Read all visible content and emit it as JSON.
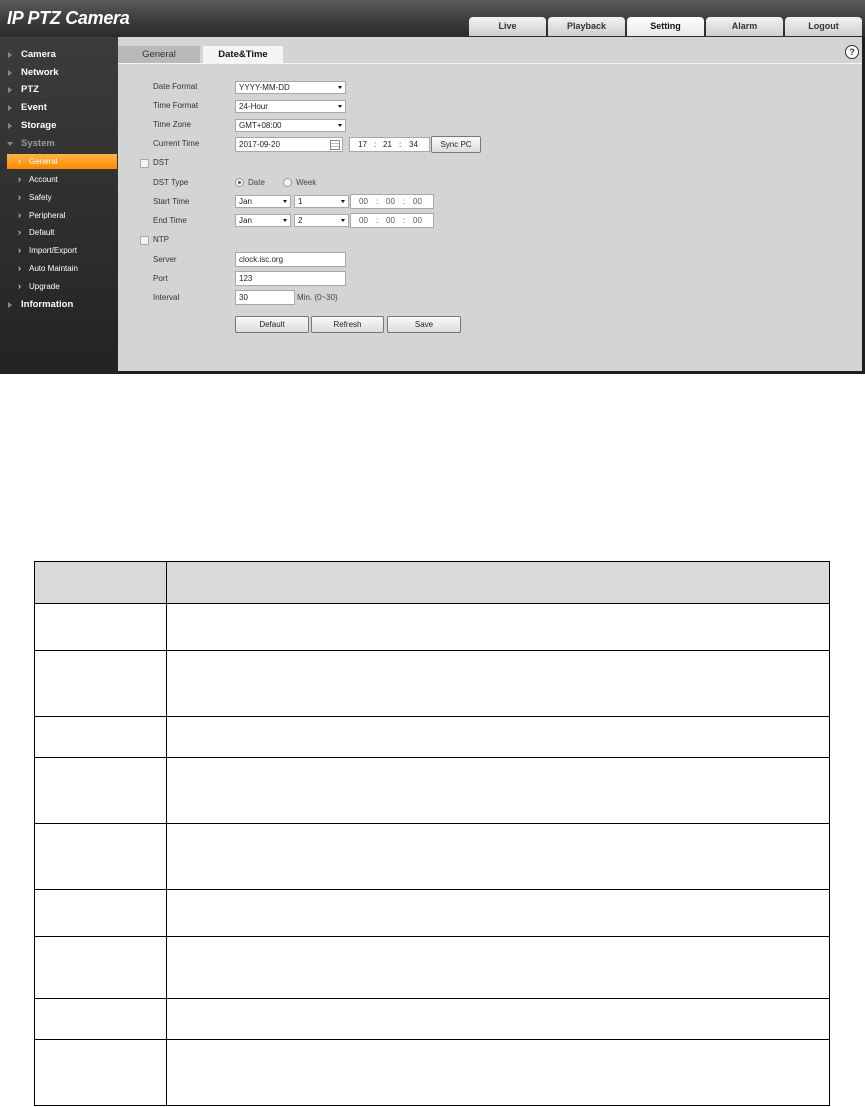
{
  "app": {
    "title": "IP PTZ Camera",
    "nav": [
      {
        "label": "Live"
      },
      {
        "label": "Playback"
      },
      {
        "label": "Setting",
        "active": true
      },
      {
        "label": "Alarm"
      },
      {
        "label": "Logout"
      }
    ]
  },
  "sidebar": {
    "menu": [
      {
        "label": "Camera"
      },
      {
        "label": "Network"
      },
      {
        "label": "PTZ"
      },
      {
        "label": "Event"
      },
      {
        "label": "Storage"
      },
      {
        "label": "System",
        "open": true
      },
      {
        "label": "Information"
      }
    ],
    "system_items": [
      {
        "label": "General",
        "active": true
      },
      {
        "label": "Account"
      },
      {
        "label": "Safety"
      },
      {
        "label": "Peripheral"
      },
      {
        "label": "Default"
      },
      {
        "label": "Import/Export"
      },
      {
        "label": "Auto Maintain"
      },
      {
        "label": "Upgrade"
      }
    ]
  },
  "content": {
    "tabs": [
      {
        "label": "General"
      },
      {
        "label": "Date&Time",
        "active": true
      }
    ],
    "help_icon": "?",
    "form": {
      "date_format": {
        "label": "Date Format",
        "value": "YYYY-MM-DD"
      },
      "time_format": {
        "label": "Time Format",
        "value": "24-Hour"
      },
      "time_zone": {
        "label": "Time Zone",
        "value": "GMT+08:00"
      },
      "current_time": {
        "label": "Current Time",
        "date": "2017-09-20",
        "hh": "17",
        "mm": "21",
        "ss": "34",
        "sync_button": "Sync PC"
      },
      "dst": {
        "label": "DST",
        "checked": false
      },
      "dst_type": {
        "label": "DST Type",
        "option_date": "Date",
        "option_week": "Week",
        "selected": "Date"
      },
      "start_time": {
        "label": "Start Time",
        "month": "Jan",
        "day": "1",
        "hh": "00",
        "mm": "00",
        "ss": "00"
      },
      "end_time": {
        "label": "End Time",
        "month": "Jan",
        "day": "2",
        "hh": "00",
        "mm": "00",
        "ss": "00"
      },
      "ntp": {
        "label": "NTP",
        "checked": false
      },
      "server": {
        "label": "Server",
        "value": "clock.isc.org"
      },
      "port": {
        "label": "Port",
        "value": "123"
      },
      "interval": {
        "label": "Interval",
        "value": "30",
        "unit": "Min. (0~30)"
      },
      "buttons": {
        "default": "Default",
        "refresh": "Refresh",
        "save": "Save"
      }
    },
    "separator": ":"
  }
}
